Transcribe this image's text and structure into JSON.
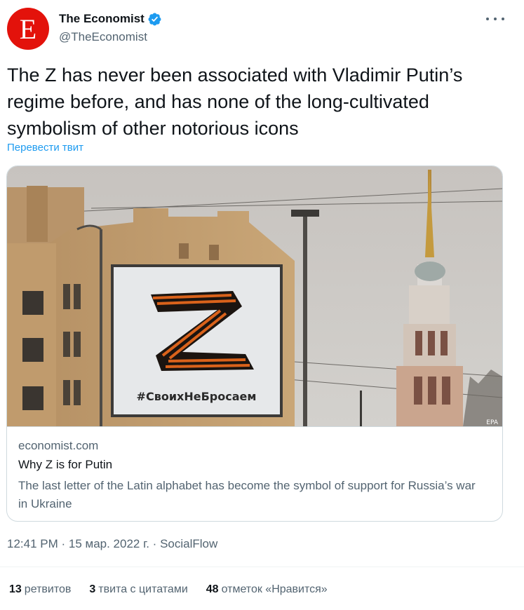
{
  "author": {
    "avatar_letter": "E",
    "avatar_color": "#e3120b",
    "display_name": "The Economist",
    "handle": "@TheEconomist",
    "verified_icon": "verified-badge-icon",
    "verified_color": "#1d9bf0"
  },
  "tweet": {
    "text": "The Z has never been associated with Vladimir Putin’s regime before, and has none of the long-cultivated symbolism of other notorious icons",
    "translate_label": "Перевести твит"
  },
  "card": {
    "image_hashtag": "#СвоихНеБросаем",
    "image_watermark": "EPA",
    "domain": "economist.com",
    "title": "Why Z is for Putin",
    "description": "The last letter of the Latin alphabet has become the symbol of support for Russia’s war in Ukraine"
  },
  "meta": {
    "time": "12:41 PM",
    "separator": " · ",
    "date": "15 мар. 2022 г.",
    "source": "SocialFlow"
  },
  "stats": {
    "retweets_count": "13",
    "retweets_label": "ретвитов",
    "quotes_count": "3",
    "quotes_label": "твита с цитатами",
    "likes_count": "48",
    "likes_label": "отметок «Нравится»"
  },
  "colors": {
    "link": "#1d9bf0",
    "secondary_text": "#536471",
    "border": "#cfd9de"
  }
}
